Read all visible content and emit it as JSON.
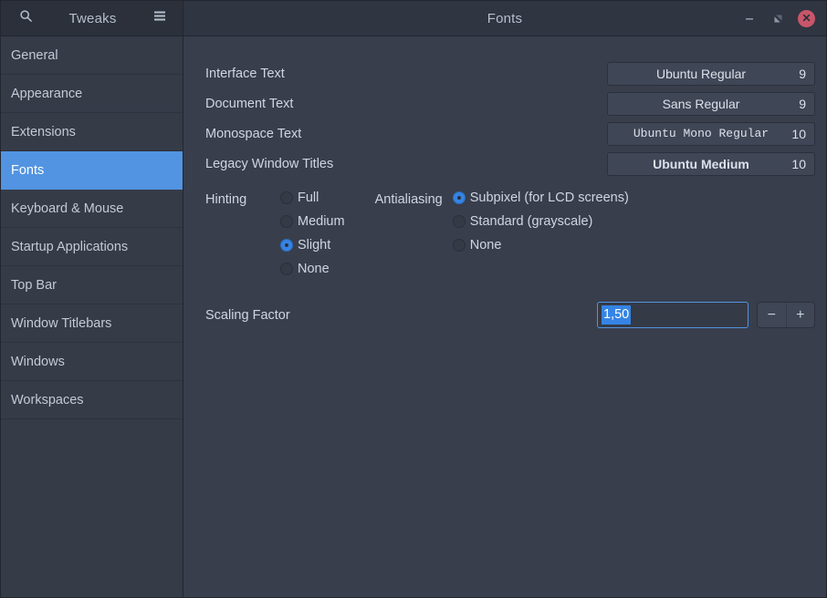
{
  "header": {
    "app_title": "Tweaks",
    "window_title": "Fonts",
    "search_icon": "search-icon",
    "menu_icon": "hamburger-menu-icon",
    "minimize_label": "–",
    "maximize_label": "❐",
    "close_label": "✕"
  },
  "sidebar": {
    "items": [
      {
        "label": "General",
        "selected": false
      },
      {
        "label": "Appearance",
        "selected": false
      },
      {
        "label": "Extensions",
        "selected": false
      },
      {
        "label": "Fonts",
        "selected": true
      },
      {
        "label": "Keyboard & Mouse",
        "selected": false
      },
      {
        "label": "Startup Applications",
        "selected": false
      },
      {
        "label": "Top Bar",
        "selected": false
      },
      {
        "label": "Window Titlebars",
        "selected": false
      },
      {
        "label": "Windows",
        "selected": false
      },
      {
        "label": "Workspaces",
        "selected": false
      }
    ]
  },
  "fonts": {
    "rows": [
      {
        "label": "Interface Text",
        "font": "Ubuntu Regular",
        "size": "9",
        "style": "regular"
      },
      {
        "label": "Document Text",
        "font": "Sans Regular",
        "size": "9",
        "style": "regular"
      },
      {
        "label": "Monospace Text",
        "font": "Ubuntu Mono Regular",
        "size": "10",
        "style": "mono"
      },
      {
        "label": "Legacy Window Titles",
        "font": "Ubuntu Medium",
        "size": "10",
        "style": "medium"
      }
    ]
  },
  "hinting": {
    "label": "Hinting",
    "options": [
      {
        "label": "Full",
        "selected": false
      },
      {
        "label": "Medium",
        "selected": false
      },
      {
        "label": "Slight",
        "selected": true
      },
      {
        "label": "None",
        "selected": false
      }
    ]
  },
  "antialiasing": {
    "label": "Antialiasing",
    "options": [
      {
        "label": "Subpixel (for LCD screens)",
        "selected": true
      },
      {
        "label": "Standard (grayscale)",
        "selected": false
      },
      {
        "label": "None",
        "selected": false
      }
    ]
  },
  "scaling": {
    "label": "Scaling Factor",
    "value": "1,50",
    "decrement_label": "−",
    "increment_label": "+"
  },
  "colors": {
    "accent": "#5294e2",
    "selection": "#3584e4",
    "close_button": "#c8566a",
    "window_bg": "#383e4c",
    "sidebar_bg": "#353b47",
    "headerbar_bg": "#2b303b"
  }
}
